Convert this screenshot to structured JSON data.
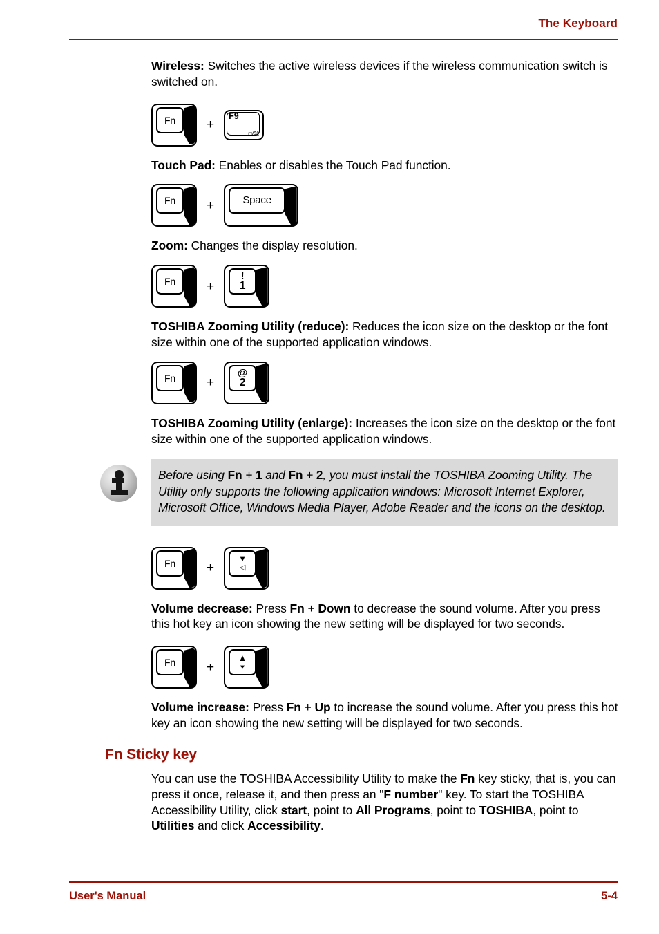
{
  "header": {
    "title": "The Keyboard",
    "rule_color": "#9c1006"
  },
  "footer": {
    "left": "User's Manual",
    "page": "5-4",
    "rule_color": "#9c1006"
  },
  "colors": {
    "accent_red": "#9c1006",
    "note_background": "#dadada",
    "body_text": "#000000"
  },
  "keys": {
    "fn_label": "Fn",
    "plus": "+",
    "space_label": "Space",
    "f9_label": "F9",
    "f9_sub": "□/⌘",
    "excl": "!",
    "one": "1",
    "at": "@",
    "two": "2",
    "arrow_down": "▼",
    "speaker_quiet": "◁",
    "arrow_up": "▲",
    "speaker_loud": "⏷"
  },
  "body": {
    "wireless": {
      "term": "Wireless:",
      "text": " Switches the active wireless devices if the wireless communication switch is switched on."
    },
    "touchpad": {
      "term": "Touch Pad:",
      "text": " Enables or disables the Touch Pad function."
    },
    "zoom": {
      "term": "Zoom:",
      "text": " Changes the display resolution."
    },
    "zoom_reduce": {
      "term": "TOSHIBA Zooming Utility (reduce):",
      "text": " Reduces the icon size on the desktop or the font size within one of the supported application windows."
    },
    "zoom_enlarge": {
      "term": "TOSHIBA Zooming Utility (enlarge):",
      "text": " Increases the icon size on the desktop or the font size within one of the supported application windows."
    },
    "volume_decrease": {
      "term": "Volume decrease:",
      "text_1": " Press ",
      "bold_1": "Fn",
      "text_2": " + ",
      "bold_2": "Down",
      "text_3": " to decrease the sound volume. After you press this hot key an icon showing the new setting will be displayed for two seconds."
    },
    "volume_increase": {
      "term": "Volume increase:",
      "text_1": " Press ",
      "bold_1": "Fn",
      "text_2": " + ",
      "bold_2": "Up",
      "text_3": " to increase the sound volume. After you press this hot key an icon showing the new setting will be displayed for two seconds."
    }
  },
  "note": {
    "icon": "info-icon",
    "seg_1": "Before using ",
    "bold_1": "Fn",
    "seg_2": " + ",
    "bold_2": "1",
    "seg_3": " and ",
    "bold_3": "Fn",
    "seg_4": " + ",
    "bold_4": "2",
    "seg_5": ", you must install the TOSHIBA Zooming Utility. The Utility only supports the following application windows: Microsoft Internet Explorer, Microsoft Office, Windows Media Player, Adobe Reader and the icons on the desktop."
  },
  "sticky": {
    "heading": "Fn Sticky key",
    "seg_1": "You can use the TOSHIBA Accessibility Utility to make the ",
    "bold_1": "Fn",
    "seg_2": " key sticky, that is, you can press it once, release it, and then press an \"",
    "bold_2": "F number",
    "seg_3": "\" key. To start the TOSHIBA Accessibility Utility, click ",
    "bold_3": "start",
    "seg_4": ", point to ",
    "bold_4": "All Programs",
    "seg_5": ", point to ",
    "bold_5": "TOSHIBA",
    "seg_6": ", point to ",
    "bold_6": "Utilities",
    "seg_7": " and click ",
    "bold_7": "Accessibility",
    "seg_8": "."
  }
}
